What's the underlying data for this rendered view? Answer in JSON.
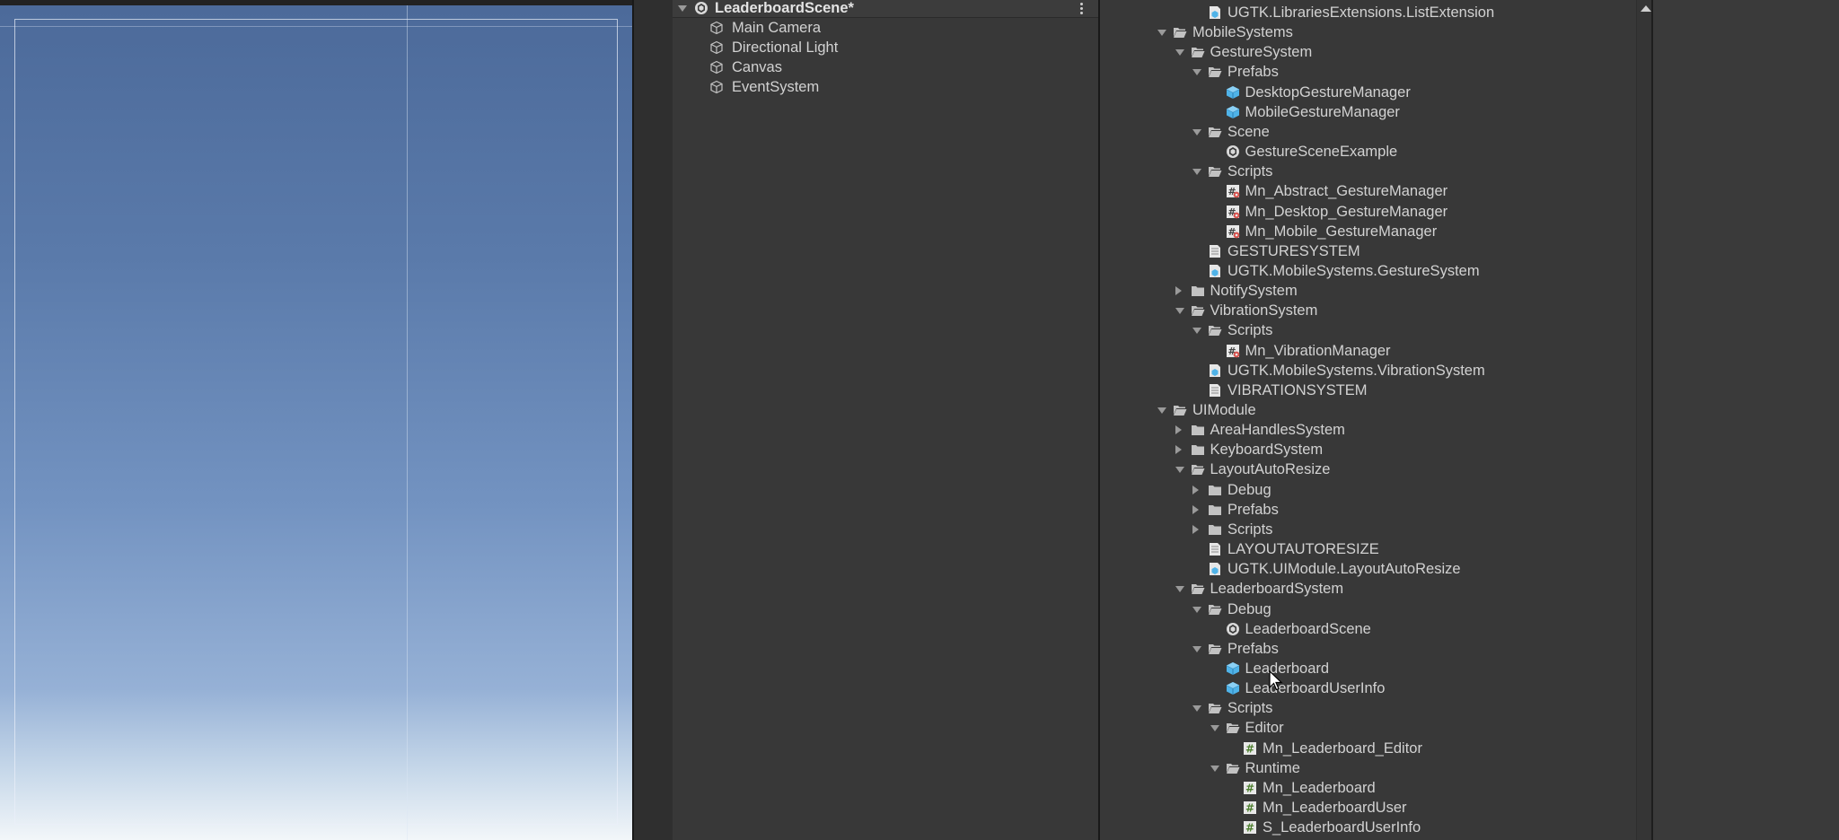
{
  "hierarchy": {
    "scene_name": "LeaderboardScene*",
    "objects": [
      "Main Camera",
      "Directional Light",
      "Canvas",
      "EventSystem"
    ]
  },
  "project": {
    "items": [
      {
        "label": "UGTK.LibrariesExtensions.ListExtension",
        "icon": "asmdef-icon",
        "depth": 3,
        "arrow": "none"
      },
      {
        "label": "MobileSystems",
        "icon": "folder-open-icon",
        "depth": 1,
        "arrow": "down"
      },
      {
        "label": "GestureSystem",
        "icon": "folder-open-icon",
        "depth": 2,
        "arrow": "down"
      },
      {
        "label": "Prefabs",
        "icon": "folder-open-icon",
        "depth": 3,
        "arrow": "down"
      },
      {
        "label": "DesktopGestureManager",
        "icon": "prefab-icon",
        "depth": 4,
        "arrow": "none"
      },
      {
        "label": "MobileGestureManager",
        "icon": "prefab-icon",
        "depth": 4,
        "arrow": "none"
      },
      {
        "label": "Scene",
        "icon": "folder-open-icon",
        "depth": 3,
        "arrow": "down"
      },
      {
        "label": "GestureSceneExample",
        "icon": "unity-scene-icon",
        "depth": 4,
        "arrow": "none"
      },
      {
        "label": "Scripts",
        "icon": "folder-open-icon",
        "depth": 3,
        "arrow": "down"
      },
      {
        "label": "Mn_Abstract_GestureManager",
        "icon": "cs-script-gear-icon",
        "depth": 4,
        "arrow": "none"
      },
      {
        "label": "Mn_Desktop_GestureManager",
        "icon": "cs-script-gear-icon",
        "depth": 4,
        "arrow": "none"
      },
      {
        "label": "Mn_Mobile_GestureManager",
        "icon": "cs-script-gear-icon",
        "depth": 4,
        "arrow": "none"
      },
      {
        "label": "GESTURESYSTEM",
        "icon": "text-file-icon",
        "depth": 3,
        "arrow": "none"
      },
      {
        "label": "UGTK.MobileSystems.GestureSystem",
        "icon": "asmdef-icon",
        "depth": 3,
        "arrow": "none"
      },
      {
        "label": "NotifySystem",
        "icon": "folder-icon",
        "depth": 2,
        "arrow": "right"
      },
      {
        "label": "VibrationSystem",
        "icon": "folder-open-icon",
        "depth": 2,
        "arrow": "down"
      },
      {
        "label": "Scripts",
        "icon": "folder-open-icon",
        "depth": 3,
        "arrow": "down"
      },
      {
        "label": "Mn_VibrationManager",
        "icon": "cs-script-gear-icon",
        "depth": 4,
        "arrow": "none"
      },
      {
        "label": "UGTK.MobileSystems.VibrationSystem",
        "icon": "asmdef-icon",
        "depth": 3,
        "arrow": "none"
      },
      {
        "label": "VIBRATIONSYSTEM",
        "icon": "text-file-icon",
        "depth": 3,
        "arrow": "none"
      },
      {
        "label": "UIModule",
        "icon": "folder-open-icon",
        "depth": 1,
        "arrow": "down"
      },
      {
        "label": "AreaHandlesSystem",
        "icon": "folder-icon",
        "depth": 2,
        "arrow": "right"
      },
      {
        "label": "KeyboardSystem",
        "icon": "folder-icon",
        "depth": 2,
        "arrow": "right"
      },
      {
        "label": "LayoutAutoResize",
        "icon": "folder-open-icon",
        "depth": 2,
        "arrow": "down"
      },
      {
        "label": "Debug",
        "icon": "folder-icon",
        "depth": 3,
        "arrow": "right"
      },
      {
        "label": "Prefabs",
        "icon": "folder-icon",
        "depth": 3,
        "arrow": "right"
      },
      {
        "label": "Scripts",
        "icon": "folder-icon",
        "depth": 3,
        "arrow": "right"
      },
      {
        "label": "LAYOUTAUTORESIZE",
        "icon": "text-file-icon",
        "depth": 3,
        "arrow": "none"
      },
      {
        "label": "UGTK.UIModule.LayoutAutoResize",
        "icon": "asmdef-icon",
        "depth": 3,
        "arrow": "none"
      },
      {
        "label": "LeaderboardSystem",
        "icon": "folder-open-icon",
        "depth": 2,
        "arrow": "down"
      },
      {
        "label": "Debug",
        "icon": "folder-open-icon",
        "depth": 3,
        "arrow": "down"
      },
      {
        "label": "LeaderboardScene",
        "icon": "unity-scene-icon",
        "depth": 4,
        "arrow": "none"
      },
      {
        "label": "Prefabs",
        "icon": "folder-open-icon",
        "depth": 3,
        "arrow": "down"
      },
      {
        "label": "Leaderboard",
        "icon": "prefab-icon",
        "depth": 4,
        "arrow": "none"
      },
      {
        "label": "LeaderboardUserInfo",
        "icon": "prefab-icon",
        "depth": 4,
        "arrow": "none"
      },
      {
        "label": "Scripts",
        "icon": "folder-open-icon",
        "depth": 3,
        "arrow": "down"
      },
      {
        "label": "Editor",
        "icon": "folder-open-icon",
        "depth": 4,
        "arrow": "down"
      },
      {
        "label": "Mn_Leaderboard_Editor",
        "icon": "cs-script-icon",
        "depth": 5,
        "arrow": "none"
      },
      {
        "label": "Runtime",
        "icon": "folder-open-icon",
        "depth": 4,
        "arrow": "down"
      },
      {
        "label": "Mn_Leaderboard",
        "icon": "cs-script-icon",
        "depth": 5,
        "arrow": "none"
      },
      {
        "label": "Mn_LeaderboardUser",
        "icon": "cs-script-icon",
        "depth": 5,
        "arrow": "none"
      },
      {
        "label": "S_LeaderboardUserInfo",
        "icon": "cs-script-icon",
        "depth": 5,
        "arrow": "none"
      }
    ]
  },
  "colors": {
    "panel_bg": "#383838",
    "text": "#d2d2d2",
    "prefab_blue": "#4fb3e8",
    "script_green": "#7fb85a"
  }
}
